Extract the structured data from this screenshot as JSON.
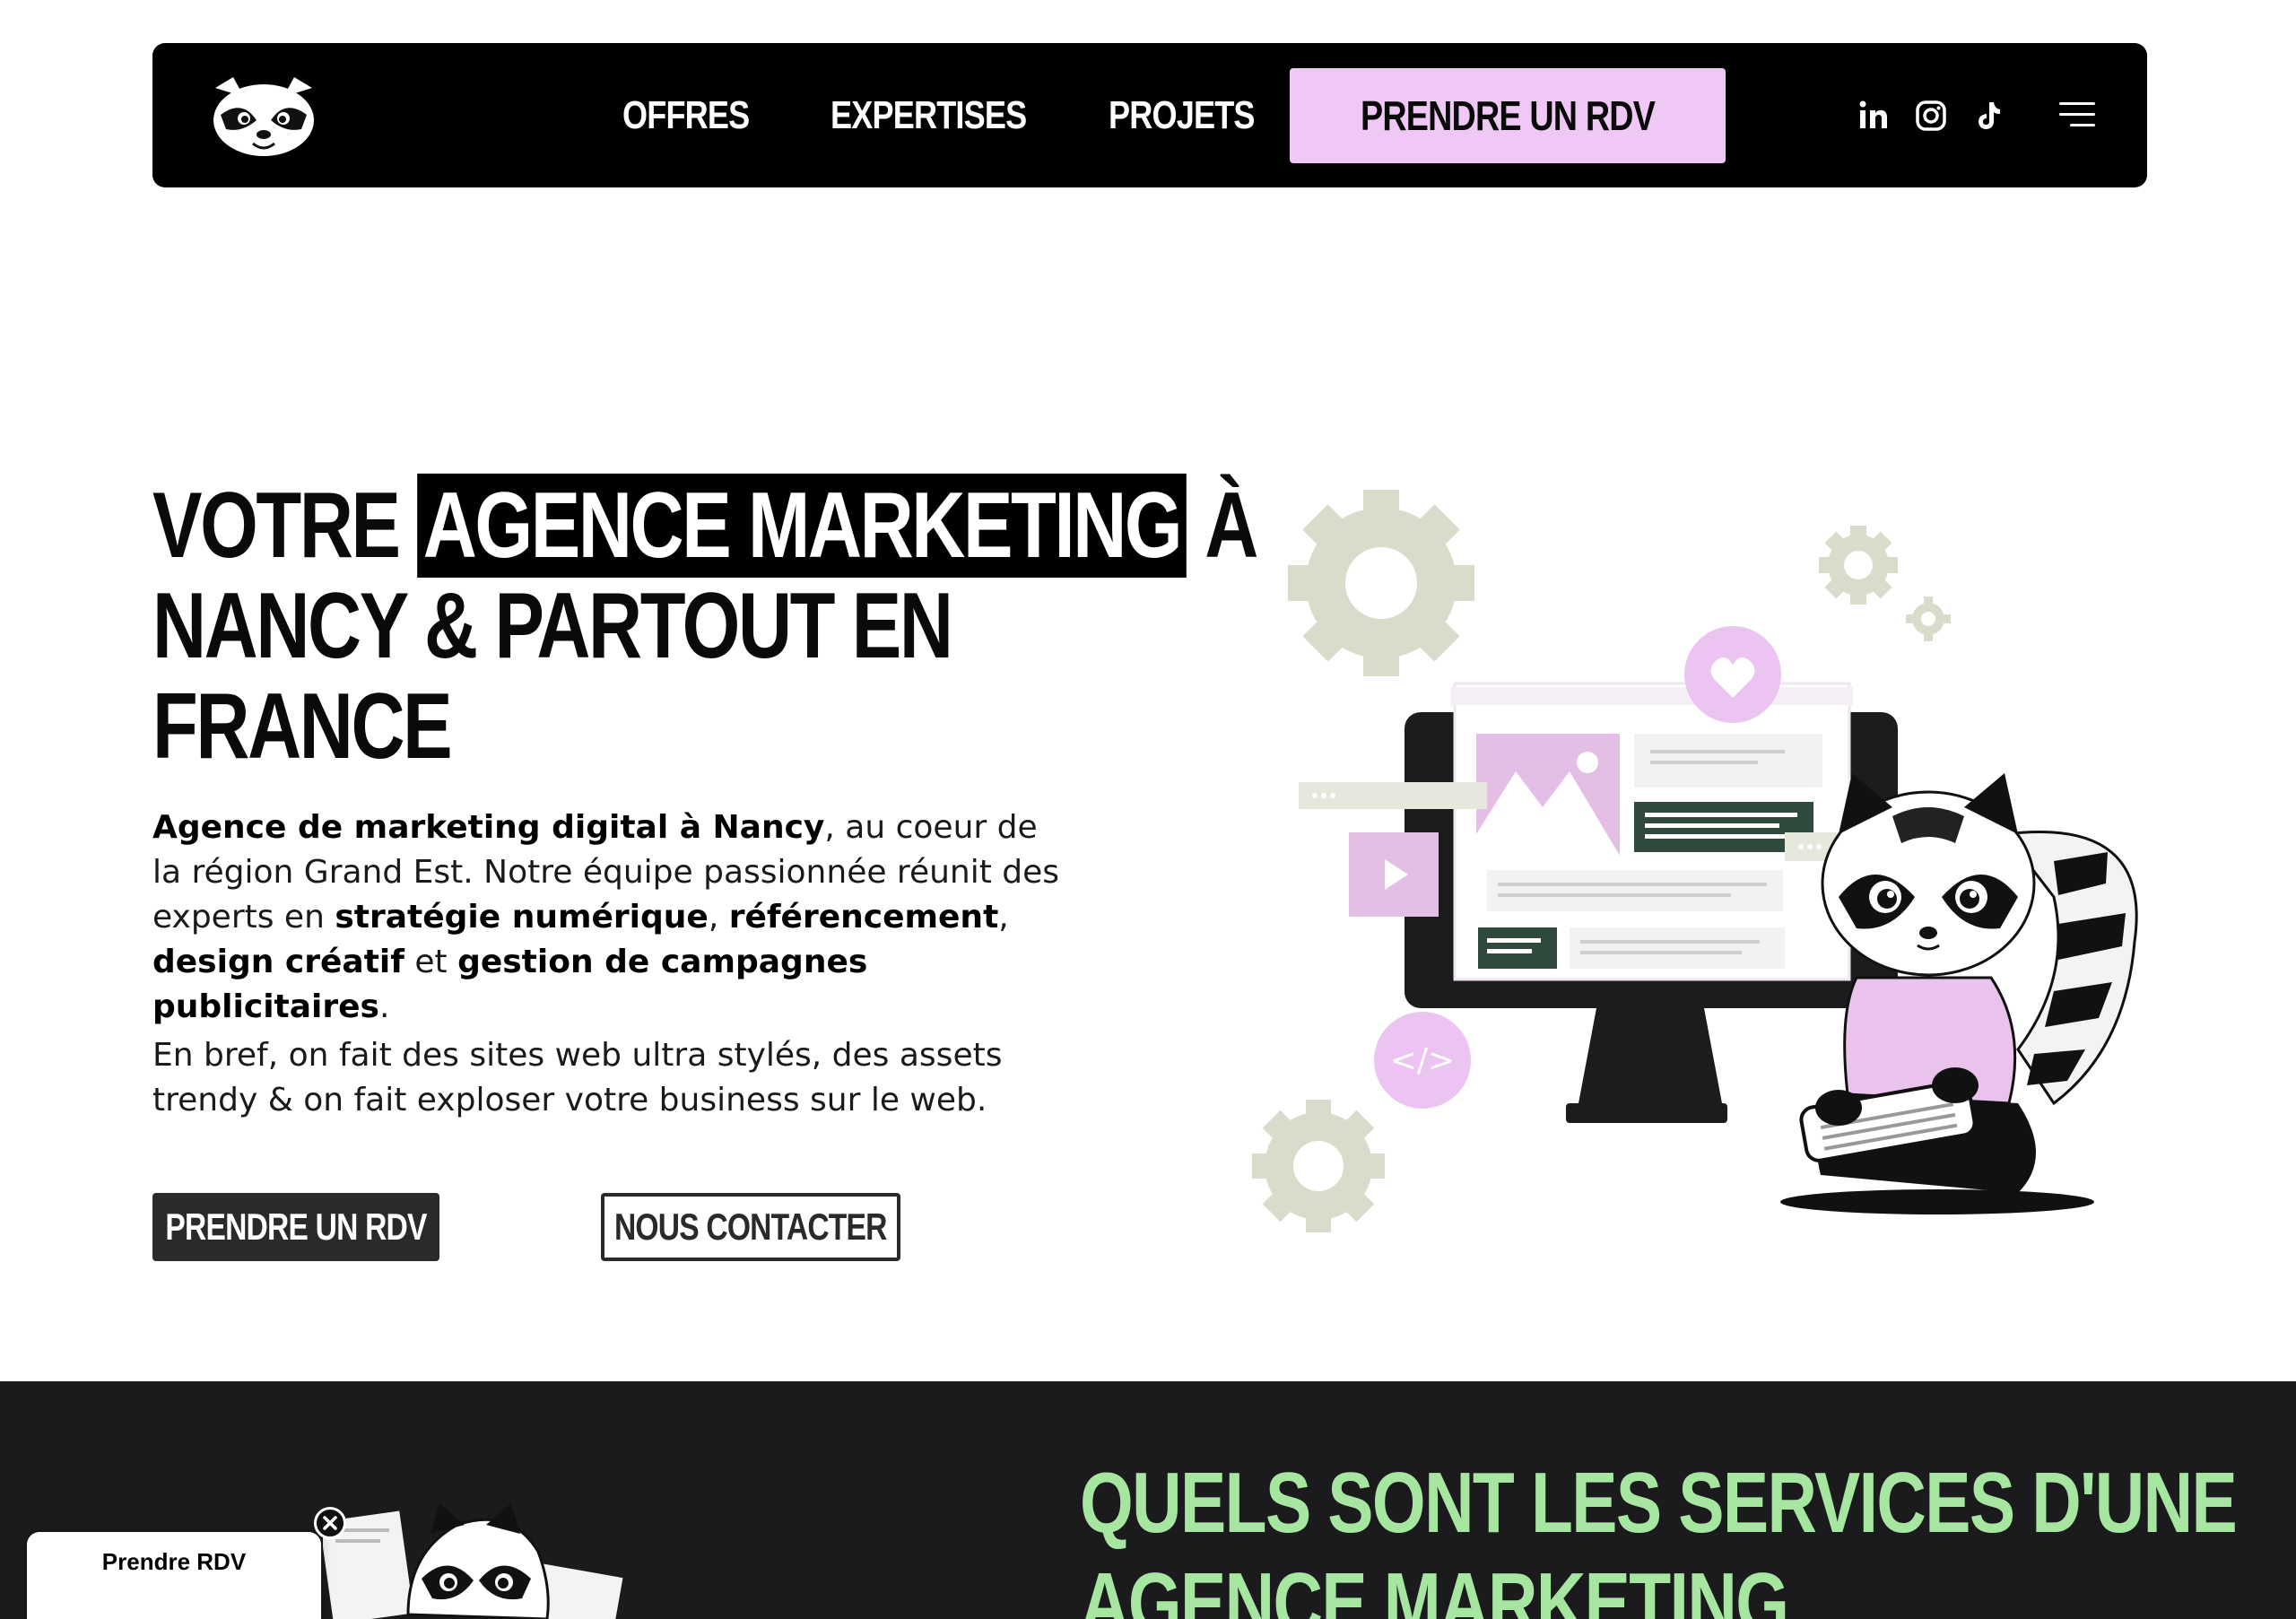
{
  "nav": {
    "logo_alt": "raccoon-logo",
    "links": [
      "OFFRES",
      "EXPERTISES",
      "PROJETS"
    ],
    "cta": "PRENDRE UN RDV",
    "social": [
      "linkedin-icon",
      "instagram-icon",
      "tiktok-icon"
    ],
    "menu_icon": "hamburger-menu-icon"
  },
  "hero": {
    "title_line1_pre": "VOTRE ",
    "title_highlight": "AGENCE MARKETING",
    "title_line1_post": " À",
    "title_line2": "NANCY & PARTOUT EN",
    "title_line3": "FRANCE",
    "p1_b1": "Agence de marketing digital à Nancy",
    "p1_t1": ", au coeur de la région Grand Est. Notre équipe passionnée réunit des experts en ",
    "p1_b2": "stratégie numérique",
    "p1_t2": ", ",
    "p1_b3": "référencement",
    "p1_t3": ", ",
    "p1_b4": "design créatif",
    "p1_t4": " et ",
    "p1_b5": "gestion de campagnes publicitaires",
    "p1_t5": ".",
    "p2": "En bref, on fait des sites web ultra stylés, des assets trendy & on fait exploser votre business sur le web.",
    "btn_primary": "PRENDRE UN RDV",
    "btn_secondary": "NOUS CONTACTER"
  },
  "services": {
    "title_line1": "QUELS SONT LES SERVICES D'UNE",
    "title_line2": "AGENCE MARKETING"
  },
  "floating": {
    "label": "Prendre RDV"
  },
  "colors": {
    "nav_bg": "#000000",
    "cta_pink": "#f0c8f6",
    "dark_section": "#1b1b1d",
    "green_title": "#a6e6a0",
    "gear_grey": "#d9dccb",
    "illu_pink": "#e9b8f0",
    "illu_green": "#2f4a3d"
  }
}
